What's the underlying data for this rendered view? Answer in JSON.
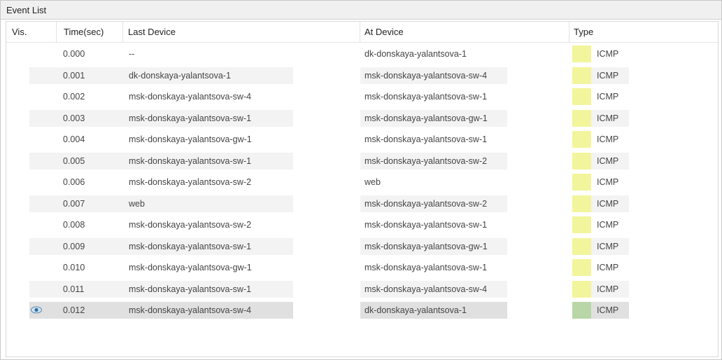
{
  "panel": {
    "title": "Event List"
  },
  "columns": {
    "vis": "Vis.",
    "time": "Time(sec)",
    "last": "Last Device",
    "at": "At Device",
    "type": "Type"
  },
  "colors": {
    "icmp": "#f2f59b",
    "icmp_selected": "#b9d6a6",
    "row_alt": "#f3f3f3",
    "row_selected": "#e0e0e0"
  },
  "rows": [
    {
      "time": "0.000",
      "last": "--",
      "at": "dk-donskaya-yalantsova-1",
      "type": "ICMP"
    },
    {
      "time": "0.001",
      "last": "dk-donskaya-yalantsova-1",
      "at": "msk-donskaya-yalantsova-sw-4",
      "type": "ICMP"
    },
    {
      "time": "0.002",
      "last": "msk-donskaya-yalantsova-sw-4",
      "at": "msk-donskaya-yalantsova-sw-1",
      "type": "ICMP"
    },
    {
      "time": "0.003",
      "last": "msk-donskaya-yalantsova-sw-1",
      "at": "msk-donskaya-yalantsova-gw-1",
      "type": "ICMP"
    },
    {
      "time": "0.004",
      "last": "msk-donskaya-yalantsova-gw-1",
      "at": "msk-donskaya-yalantsova-sw-1",
      "type": "ICMP"
    },
    {
      "time": "0.005",
      "last": "msk-donskaya-yalantsova-sw-1",
      "at": "msk-donskaya-yalantsova-sw-2",
      "type": "ICMP"
    },
    {
      "time": "0.006",
      "last": "msk-donskaya-yalantsova-sw-2",
      "at": "web",
      "type": "ICMP"
    },
    {
      "time": "0.007",
      "last": "web",
      "at": "msk-donskaya-yalantsova-sw-2",
      "type": "ICMP"
    },
    {
      "time": "0.008",
      "last": "msk-donskaya-yalantsova-sw-2",
      "at": "msk-donskaya-yalantsova-sw-1",
      "type": "ICMP"
    },
    {
      "time": "0.009",
      "last": "msk-donskaya-yalantsova-sw-1",
      "at": "msk-donskaya-yalantsova-gw-1",
      "type": "ICMP"
    },
    {
      "time": "0.010",
      "last": "msk-donskaya-yalantsova-gw-1",
      "at": "msk-donskaya-yalantsova-sw-1",
      "type": "ICMP"
    },
    {
      "time": "0.011",
      "last": "msk-donskaya-yalantsova-sw-1",
      "at": "msk-donskaya-yalantsova-sw-4",
      "type": "ICMP"
    },
    {
      "time": "0.012",
      "last": "msk-donskaya-yalantsova-sw-4",
      "at": "dk-donskaya-yalantsova-1",
      "type": "ICMP",
      "selected": true,
      "visible_icon": "eye-icon"
    }
  ]
}
